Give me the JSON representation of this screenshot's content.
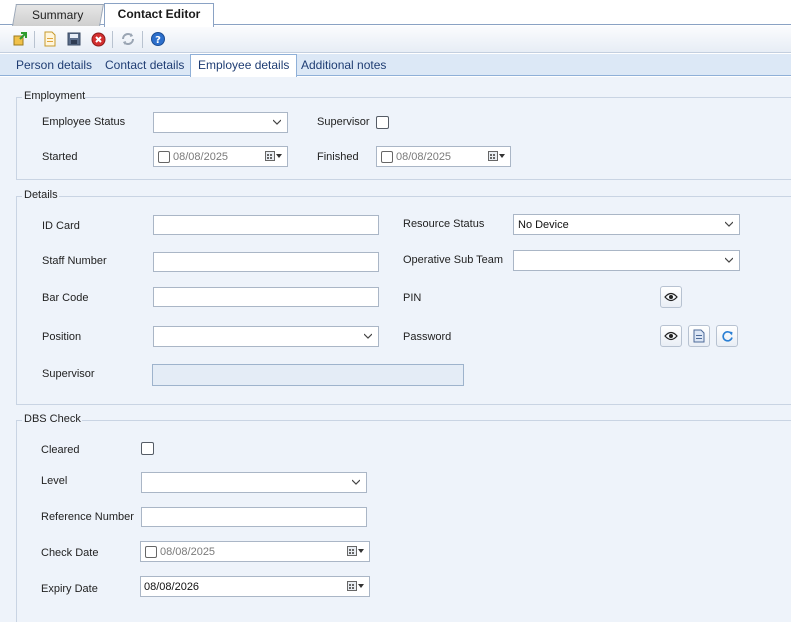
{
  "doc_tabs": {
    "summary": "Summary",
    "contact_editor": "Contact Editor"
  },
  "toolbar": {
    "icons": [
      "add-contact-icon",
      "new-document-icon",
      "save-icon",
      "cancel-icon",
      "refresh-icon",
      "help-icon"
    ]
  },
  "inner_tabs": [
    "Person details",
    "Contact details",
    "Employee details",
    "Additional notes"
  ],
  "employment": {
    "title": "Employment",
    "employee_status_label": "Employee Status",
    "employee_status_value": "",
    "supervisor_label": "Supervisor",
    "started_label": "Started",
    "started_value": "08/08/2025",
    "finished_label": "Finished",
    "finished_value": "08/08/2025"
  },
  "details": {
    "title": "Details",
    "id_card_label": "ID Card",
    "staff_number_label": "Staff Number",
    "bar_code_label": "Bar Code",
    "position_label": "Position",
    "supervisor_label": "Supervisor",
    "resource_status_label": "Resource Status",
    "resource_status_value": "No Device",
    "operative_sub_team_label": "Operative Sub Team",
    "pin_label": "PIN",
    "password_label": "Password"
  },
  "dbs": {
    "title": "DBS Check",
    "cleared_label": "Cleared",
    "level_label": "Level",
    "reference_number_label": "Reference Number",
    "check_date_label": "Check Date",
    "check_date_value": "08/08/2025",
    "expiry_date_label": "Expiry Date",
    "expiry_date_value": "08/08/2026"
  },
  "colors": {
    "tab_text": "#1f3d73",
    "panel_bg": "#eef3fa",
    "refresh_blue": "#2a7fd4",
    "cancel_red": "#d32f2f"
  }
}
